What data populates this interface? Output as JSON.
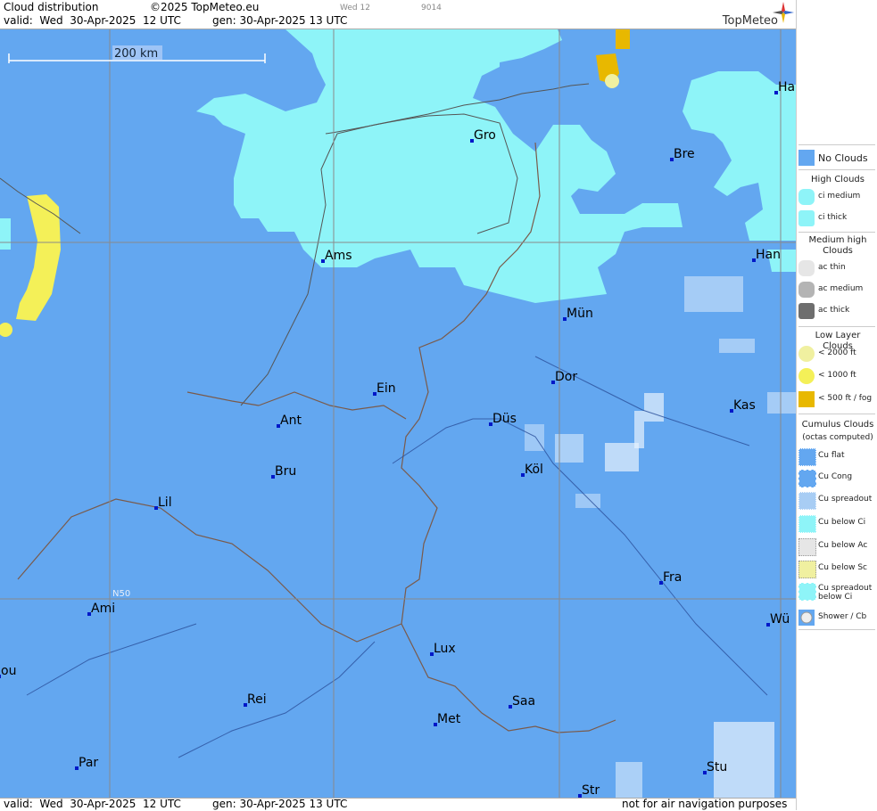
{
  "header": {
    "title": "Cloud distribution",
    "copyright": "©2025 TopMeteo.eu",
    "valid": "valid:  Wed  30-Apr-2025  12 UTC",
    "gen": "gen: 30-Apr-2025 13 UTC",
    "tab_day": "Wed 12",
    "tab_code": "9014",
    "logo": "TopMeteo"
  },
  "map": {
    "scale_label": "200 km",
    "grid_label": "N50",
    "cities": [
      {
        "name": "Ha"
      },
      {
        "name": "Gro"
      },
      {
        "name": "Bre"
      },
      {
        "name": "Ams"
      },
      {
        "name": "Han"
      },
      {
        "name": "Mün"
      },
      {
        "name": "Ein"
      },
      {
        "name": "Dor"
      },
      {
        "name": "Ant"
      },
      {
        "name": "Kas"
      },
      {
        "name": "Düs"
      },
      {
        "name": "Bru"
      },
      {
        "name": "Köl"
      },
      {
        "name": "Lil"
      },
      {
        "name": "Fra"
      },
      {
        "name": "Ami"
      },
      {
        "name": "Wü"
      },
      {
        "name": "Lux"
      },
      {
        "name": "ou"
      },
      {
        "name": "Rei"
      },
      {
        "name": "Saa"
      },
      {
        "name": "Met"
      },
      {
        "name": "Stu"
      },
      {
        "name": "Par"
      },
      {
        "name": "Str"
      }
    ]
  },
  "footer": {
    "valid": "valid:  Wed  30-Apr-2025  12 UTC",
    "gen": "gen: 30-Apr-2025 13 UTC",
    "disclaimer": "not for air navigation purposes"
  },
  "legend": {
    "no_clouds": "No Clouds",
    "high_head": "High Clouds",
    "ci_medium": "ci medium",
    "ci_thick": "ci thick",
    "medium_head": "Medium high Clouds",
    "ac_thin": "ac thin",
    "ac_medium": "ac medium",
    "ac_thick": "ac thick",
    "low_head": "Low Layer Clouds",
    "low_2000": "< 2000 ft",
    "low_1000": "< 1000 ft",
    "low_500": "< 500 ft / fog",
    "cu_head": "Cumulus Clouds",
    "cu_sub": "(octas computed)",
    "cu_flat": "Cu flat",
    "cu_cong": "Cu Cong",
    "cu_spreadout": "Cu spreadout",
    "cu_below_ci": "Cu below Ci",
    "cu_below_ac": "Cu below Ac",
    "cu_below_sc": "Cu below Sc",
    "cu_spread_ci": "Cu spreadout below Ci",
    "shower": "Shower / Cb"
  },
  "colors": {
    "no_clouds": "#63a7f0",
    "ci": "#8ef4f8",
    "low_2000": "#f0f0a0",
    "low_1000": "#f4f058",
    "fog": "#e8b800",
    "ac_thin": "#e6e6e6",
    "ac_medium": "#b4b4b4",
    "ac_thick": "#6e6e6e"
  }
}
